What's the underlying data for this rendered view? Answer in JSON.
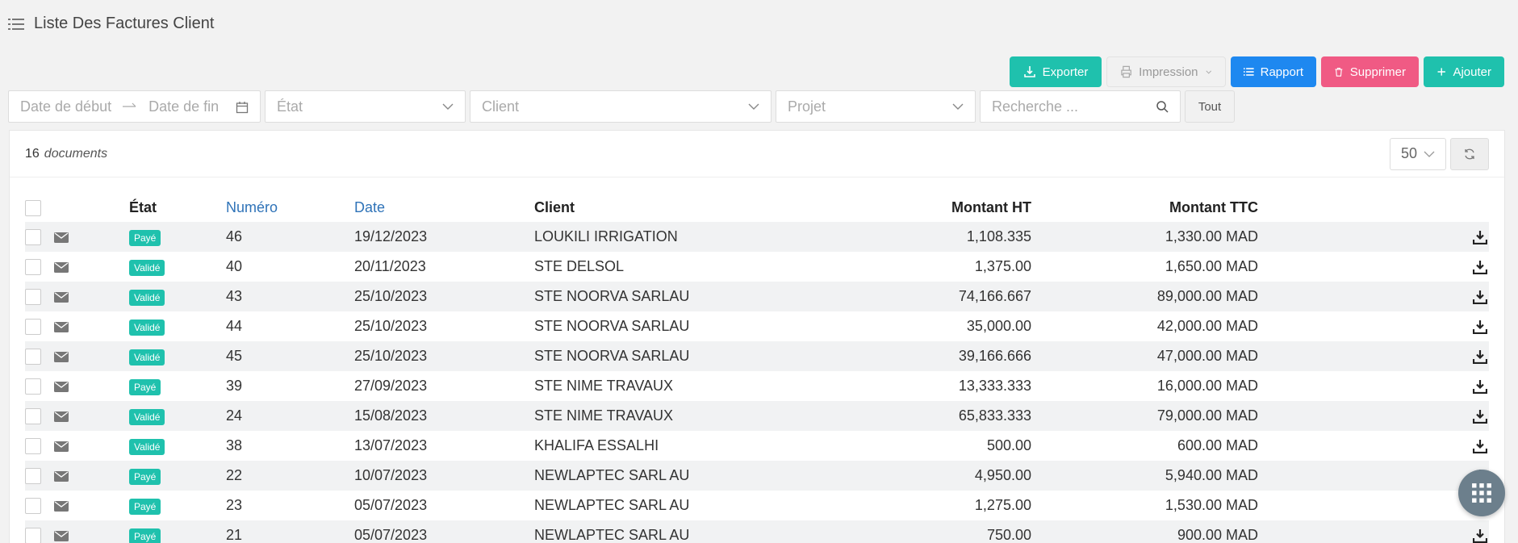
{
  "header": {
    "title": "Liste Des Factures Client"
  },
  "toolbar": {
    "export_label": "Exporter",
    "print_label": "Impression",
    "report_label": "Rapport",
    "delete_label": "Supprimer",
    "add_label": "Ajouter"
  },
  "filters": {
    "date_start_placeholder": "Date de début",
    "date_end_placeholder": "Date de fin",
    "etat_placeholder": "État",
    "client_placeholder": "Client",
    "projet_placeholder": "Projet",
    "search_placeholder": "Recherche ...",
    "all_label": "Tout"
  },
  "panel": {
    "count": "16",
    "count_label": "documents",
    "per_page": "50"
  },
  "table": {
    "headers": {
      "etat": "État",
      "numero": "Numéro",
      "date": "Date",
      "client": "Client",
      "ht": "Montant HT",
      "ttc": "Montant TTC"
    },
    "rows": [
      {
        "etat": "Payé",
        "numero": "46",
        "date": "19/12/2023",
        "client": "LOUKILI IRRIGATION",
        "ht": "1,108.335",
        "ttc": "1,330.00 MAD"
      },
      {
        "etat": "Validé",
        "numero": "40",
        "date": "20/11/2023",
        "client": "STE DELSOL",
        "ht": "1,375.00",
        "ttc": "1,650.00 MAD"
      },
      {
        "etat": "Validé",
        "numero": "43",
        "date": "25/10/2023",
        "client": "STE NOORVA SARLAU",
        "ht": "74,166.667",
        "ttc": "89,000.00 MAD"
      },
      {
        "etat": "Validé",
        "numero": "44",
        "date": "25/10/2023",
        "client": "STE NOORVA SARLAU",
        "ht": "35,000.00",
        "ttc": "42,000.00 MAD"
      },
      {
        "etat": "Validé",
        "numero": "45",
        "date": "25/10/2023",
        "client": "STE NOORVA SARLAU",
        "ht": "39,166.666",
        "ttc": "47,000.00 MAD"
      },
      {
        "etat": "Payé",
        "numero": "39",
        "date": "27/09/2023",
        "client": "STE NIME TRAVAUX",
        "ht": "13,333.333",
        "ttc": "16,000.00 MAD"
      },
      {
        "etat": "Validé",
        "numero": "24",
        "date": "15/08/2023",
        "client": "STE NIME TRAVAUX",
        "ht": "65,833.333",
        "ttc": "79,000.00 MAD"
      },
      {
        "etat": "Validé",
        "numero": "38",
        "date": "13/07/2023",
        "client": "KHALIFA ESSALHI",
        "ht": "500.00",
        "ttc": "600.00 MAD"
      },
      {
        "etat": "Payé",
        "numero": "22",
        "date": "10/07/2023",
        "client": "NEWLAPTEC SARL AU",
        "ht": "4,950.00",
        "ttc": "5,940.00 MAD"
      },
      {
        "etat": "Payé",
        "numero": "23",
        "date": "05/07/2023",
        "client": "NEWLAPTEC SARL AU",
        "ht": "1,275.00",
        "ttc": "1,530.00 MAD"
      },
      {
        "etat": "Payé",
        "numero": "21",
        "date": "05/07/2023",
        "client": "NEWLAPTEC SARL AU",
        "ht": "750.00",
        "ttc": "900.00 MAD"
      }
    ]
  },
  "colors": {
    "teal": "#1fc1ad",
    "blue": "#1e88f0",
    "pink": "#f05a84",
    "link": "#2f73b8"
  },
  "icons": [
    "list-icon",
    "export-icon",
    "printer-icon",
    "list-report-icon",
    "trash-icon",
    "plus-icon",
    "calendar-icon",
    "search-icon",
    "refresh-icon",
    "mail-icon",
    "download-icon",
    "apps-grid-icon"
  ]
}
